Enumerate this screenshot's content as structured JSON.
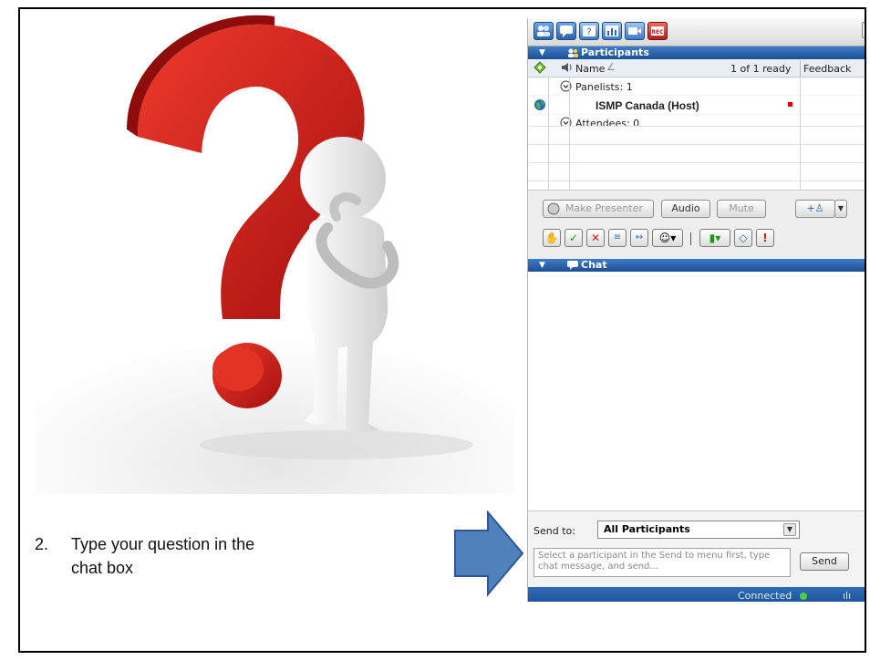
{
  "slide": {
    "instruction_number": "2.",
    "instruction_text": "Type your question in the chat box"
  },
  "panel": {
    "close_glyph": "×",
    "toolbar_icons": [
      "participants-icon",
      "chat-icon",
      "qa-icon",
      "polling-icon",
      "video-icon",
      "record-icon"
    ],
    "record_label": "REC",
    "participants": {
      "title": "Participants",
      "col_name": "Name",
      "col_ready": "1 of 1 ready",
      "col_feedback": "Feedback",
      "panelists_label": "Panelists: 1",
      "host_name": "ISMP Canada (Host)",
      "attendees_label": "Attendees: 0"
    },
    "controls": {
      "make_presenter": "Make Presenter",
      "audio": "Audio",
      "mute": "Mute"
    },
    "chat": {
      "title": "Chat",
      "send_to_label": "Send to:",
      "send_to_value": "All Participants",
      "message_placeholder": "Select a participant in the Send to menu first, type chat message, and send...",
      "send_button": "Send"
    },
    "status": "Connected"
  },
  "colors": {
    "accent_blue": "#2d6bb8",
    "arrow_fill": "#4f81bd",
    "question_mark": "#c8201c"
  }
}
